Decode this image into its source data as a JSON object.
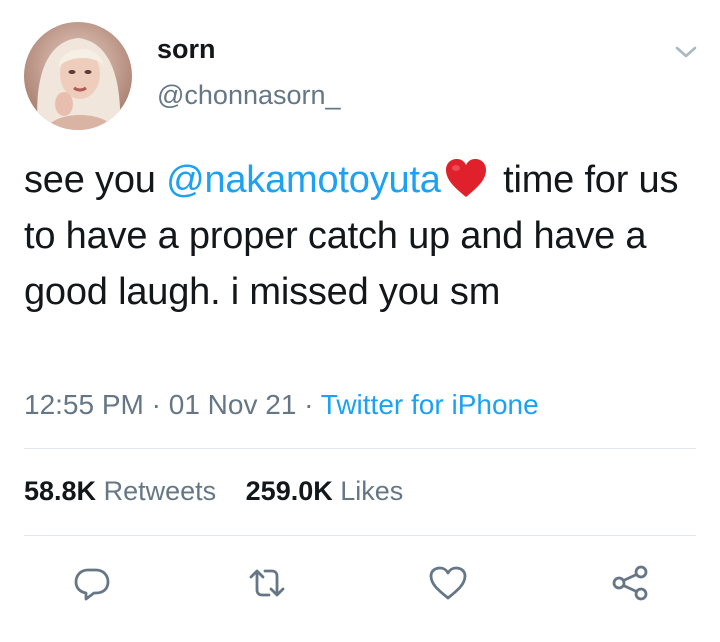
{
  "author": {
    "display_name": "sorn",
    "handle": "@chonnasorn_"
  },
  "tweet": {
    "text_before": "see you ",
    "mention": "@nakamotoyuta",
    "text_after": " time for us to have a proper catch up and have a good laugh. i missed you sm"
  },
  "meta": {
    "time": "12:55 PM",
    "separator1": " · ",
    "date": "01 Nov 21",
    "separator2": " · ",
    "source": "Twitter for iPhone"
  },
  "stats": {
    "retweets_count": "58.8K",
    "retweets_label": "Retweets",
    "likes_count": "259.0K",
    "likes_label": "Likes"
  },
  "icons": {
    "caret": "chevron-down-icon",
    "reply": "reply-icon",
    "retweet": "retweet-icon",
    "like": "heart-icon",
    "share": "share-icon"
  },
  "colors": {
    "link": "#1da1f2",
    "secondary_text": "#657786",
    "primary_text": "#14171a",
    "divider": "#e1e8ed",
    "heart_emoji": "#e0202b"
  }
}
